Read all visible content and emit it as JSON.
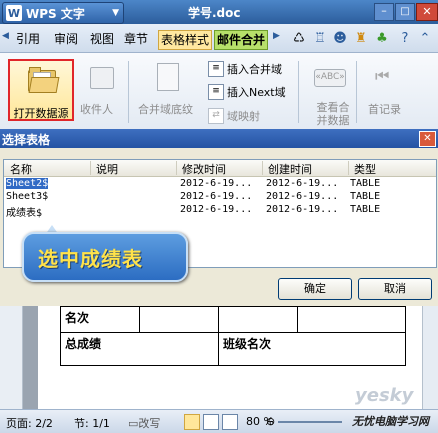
{
  "app": {
    "name": "WPS 文字",
    "logo_letter": "W",
    "document_title": "学号.doc",
    "window_buttons": {
      "minimize": "–",
      "maximize": "□",
      "close": "✕"
    }
  },
  "tabs": [
    "引用",
    "审阅",
    "视图",
    "章节",
    "表格样式",
    "邮件合并"
  ],
  "ribbon": {
    "open_data_source": "打开数据源",
    "recipients": "收件人",
    "merge_field_shading": "合并域底纹",
    "insert_merge_field": "插入合并域",
    "insert_next": "插入Next域",
    "field_mapping": "域映射",
    "view_merged_data": "查看合并数据",
    "abc_tag": "«ABC»",
    "first_record": "首记录"
  },
  "dialog": {
    "title": "选择表格",
    "columns": [
      "名称",
      "说明",
      "修改时间",
      "创建时间",
      "类型"
    ],
    "rows": [
      {
        "name": "Sheet2$",
        "desc": "",
        "modified": "2012-6-19...",
        "created": "2012-6-19...",
        "type": "TABLE",
        "selected": true
      },
      {
        "name": "Sheet3$",
        "desc": "",
        "modified": "2012-6-19...",
        "created": "2012-6-19...",
        "type": "TABLE",
        "selected": false
      },
      {
        "name": "成绩表$",
        "desc": "",
        "modified": "2012-6-19...",
        "created": "2012-6-19...",
        "type": "TABLE",
        "selected": false
      }
    ],
    "callout": "选中成绩表",
    "ok": "确定",
    "cancel": "取消"
  },
  "document": {
    "cell_rank": "名次",
    "cell_total": "总成绩",
    "cell_class_rank": "班级名次"
  },
  "status": {
    "page": "页面: 2/2",
    "section": "节: 1/1",
    "overwrite": "改写",
    "zoom": "80 %",
    "site": "无忧电脑学习网"
  },
  "watermark": "yesky",
  "colors": {
    "accent": "#2c5d9c",
    "highlight_border": "#e0262a",
    "callout": "#2c6dc2",
    "callout_text": "#ffe24a"
  }
}
